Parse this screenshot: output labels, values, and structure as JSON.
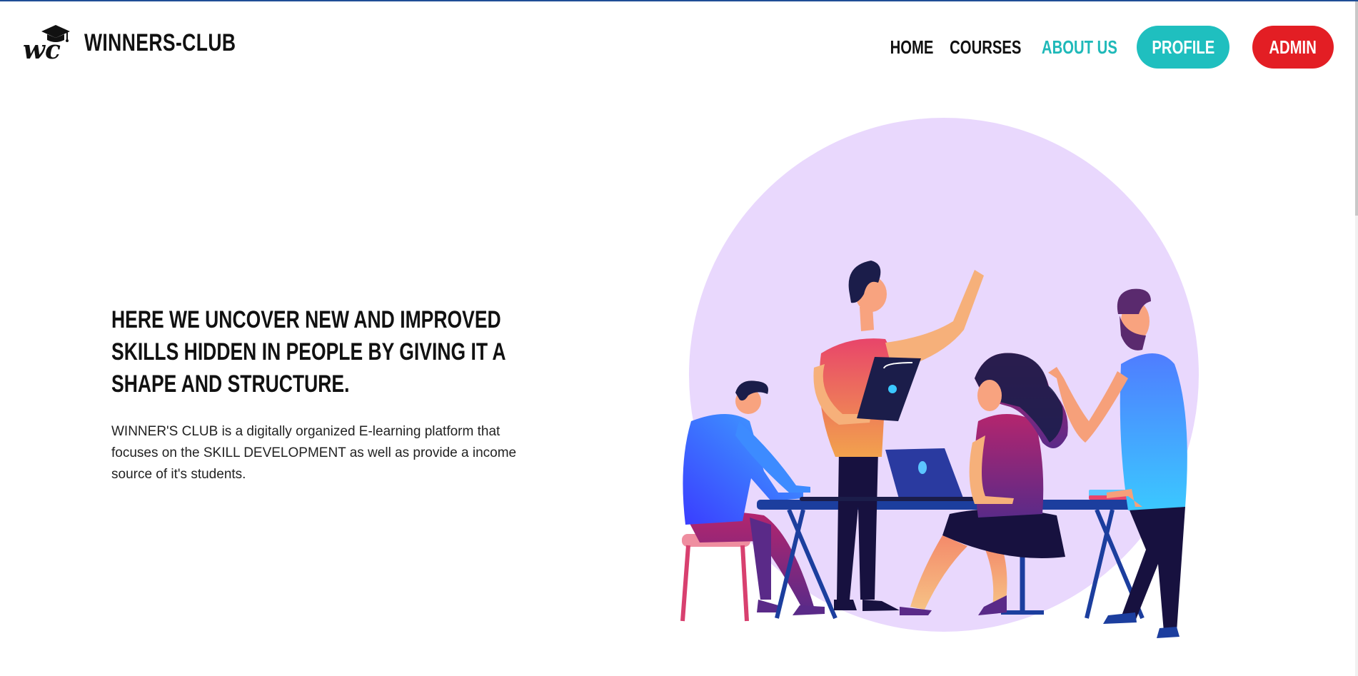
{
  "brand": {
    "logo_text": "WINNERS-CLUB",
    "logo_mark": "wc",
    "logo_icon": "graduation-cap-icon"
  },
  "nav": {
    "items": [
      {
        "label": "HOME",
        "active": false
      },
      {
        "label": "COURSES",
        "active": false
      },
      {
        "label": "ABOUT US",
        "active": true
      }
    ],
    "profile_label": "PROFILE",
    "admin_label": "ADMIN"
  },
  "hero": {
    "title": "HERE WE UNCOVER NEW AND IMPROVED SKILLS HIDDEN IN PEOPLE BY GIVING IT A SHAPE AND STRUCTURE.",
    "description": "WINNER'S CLUB is a digitally organized E-learning platform that focuses on the SKILL DEVELOPMENT as well as provide a income source of it's students."
  },
  "colors": {
    "accent_teal": "#1fbfbf",
    "admin_red": "#e31e24",
    "circle_lavender": "#e9d8fd",
    "top_line": "#1f4e96"
  },
  "illustration": {
    "subject": "team-collaboration-illustration"
  }
}
